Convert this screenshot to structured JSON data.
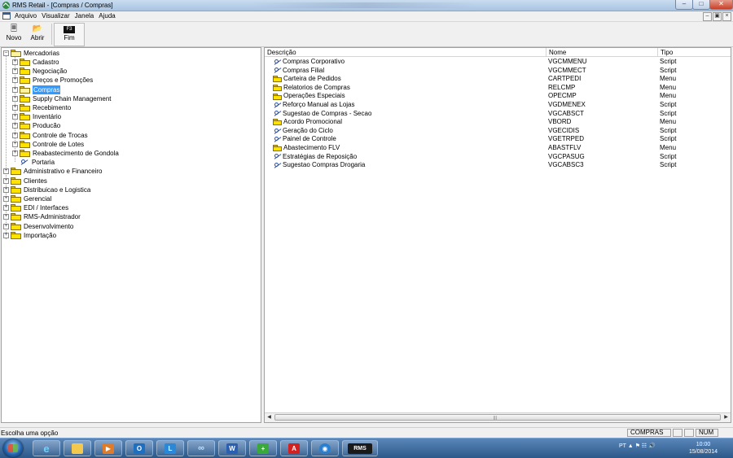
{
  "window": {
    "title": "RMS Retail - [Compras / Compras]"
  },
  "menu": {
    "items": [
      "Arquivo",
      "Visualizar",
      "Janela",
      "Ajuda"
    ]
  },
  "toolbar": {
    "novo": "Novo",
    "abrir": "Abrir",
    "fim_key": "F3",
    "fim": "Fim"
  },
  "tree": {
    "root": "Mercadorias",
    "children": [
      "Cadastro",
      "Negociação",
      "Preços e Promoções",
      "Compras",
      "Supply Chain Management",
      "Recebimento",
      "Inventário",
      "Producão",
      "Controle de Trocas",
      "Controle de Lotes",
      "Reabastecimento de Gondola",
      "Portaria"
    ],
    "siblings": [
      "Administrativo e Financeiro",
      "Clientes",
      "Distribuicao e Logistica",
      "Gerencial",
      "EDI / Interfaces",
      "RMS-Administrador",
      "Desenvolvimento",
      "Importação"
    ]
  },
  "list": {
    "headers": [
      "Descrição",
      "Nome",
      "Tipo"
    ],
    "rows": [
      {
        "desc": "Compras Corporativo",
        "nome": "VGCMMENU",
        "tipo": "Script",
        "icon": "script"
      },
      {
        "desc": "Compras Filial",
        "nome": "VGCMMECT",
        "tipo": "Script",
        "icon": "script"
      },
      {
        "desc": "Carteira de Pedidos",
        "nome": "CARTPEDI",
        "tipo": "Menu",
        "icon": "folder"
      },
      {
        "desc": "Relatorios de Compras",
        "nome": "RELCMP",
        "tipo": "Menu",
        "icon": "folder"
      },
      {
        "desc": "Operações Especiais",
        "nome": "OPECMP",
        "tipo": "Menu",
        "icon": "folder"
      },
      {
        "desc": "Reforço Manual as Lojas",
        "nome": "VGDMENEX",
        "tipo": "Script",
        "icon": "script"
      },
      {
        "desc": "Sugestao de Compras - Secao",
        "nome": "VGCABSCT",
        "tipo": "Script",
        "icon": "script"
      },
      {
        "desc": "Acordo Promocional",
        "nome": "VBORD",
        "tipo": "Menu",
        "icon": "folder"
      },
      {
        "desc": "Geração do Ciclo",
        "nome": "VGECIDIS",
        "tipo": "Script",
        "icon": "script"
      },
      {
        "desc": "Painel de Controle",
        "nome": "VGETRPED",
        "tipo": "Script",
        "icon": "script"
      },
      {
        "desc": "Abastecimento FLV",
        "nome": "ABASTFLV",
        "tipo": "Menu",
        "icon": "folder"
      },
      {
        "desc": "Estratégias de Reposição",
        "nome": "VGCPASUG",
        "tipo": "Script",
        "icon": "script"
      },
      {
        "desc": "Sugestao Compras Drogaria",
        "nome": "VGCABSC3",
        "tipo": "Script",
        "icon": "script"
      }
    ]
  },
  "status": {
    "message": "Escolha uma opção",
    "module": "COMPRAS",
    "num": "NUM"
  },
  "taskbar": {
    "rms_label": "RMS",
    "lang": "PT",
    "time": "10:00",
    "date": "15/08/2014",
    "colors": {
      "accent": "#3399ff",
      "folder": "#ffe300"
    }
  }
}
